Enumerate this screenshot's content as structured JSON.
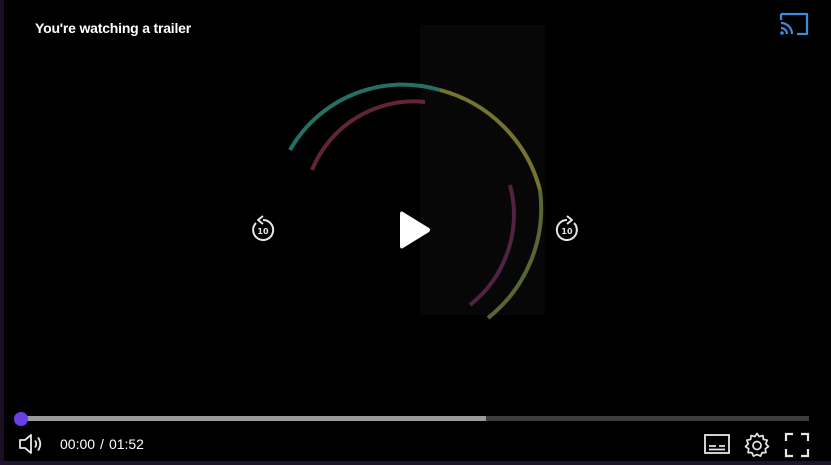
{
  "player": {
    "title": "You're watching a trailer",
    "accent_color": "#6b3fe6",
    "cast_color": "#3a8dde",
    "icons": {
      "cast": "cast-icon",
      "rewind": "rewind-10-icon",
      "play": "play-icon",
      "forward": "forward-10-icon",
      "volume": "volume-icon",
      "subtitles": "subtitles-icon",
      "settings": "gear-icon",
      "fullscreen": "fullscreen-icon"
    },
    "skip_seconds": "10",
    "progress": {
      "played_fraction": 0,
      "buffered_fraction": 0.59
    },
    "time": {
      "current": "00:00",
      "separator": "/",
      "duration": "01:52"
    }
  }
}
